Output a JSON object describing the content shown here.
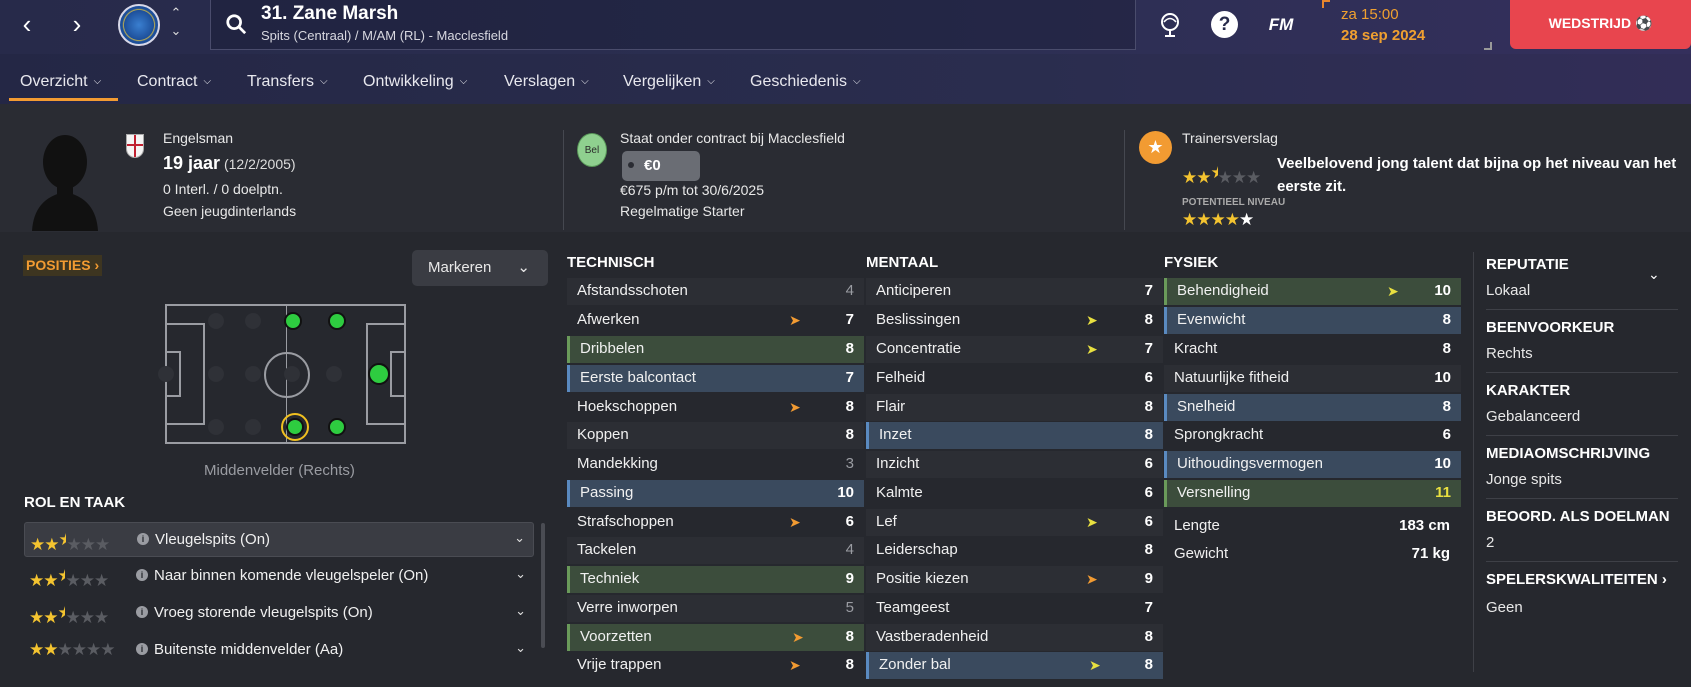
{
  "topbar": {
    "player_title": "31. Zane Marsh",
    "player_subtitle": "Spits (Centraal) / M/AM (RL) - Macclesfield",
    "fm_label": "FM",
    "help_label": "?",
    "time": "za 15:00",
    "date": "28 sep 2024",
    "match_button": "WEDSTRIJD"
  },
  "tabs": [
    {
      "label": "Overzicht"
    },
    {
      "label": "Contract"
    },
    {
      "label": "Transfers"
    },
    {
      "label": "Ontwikkeling"
    },
    {
      "label": "Verslagen"
    },
    {
      "label": "Vergelijken"
    },
    {
      "label": "Geschiedenis"
    }
  ],
  "header": {
    "nationality": "Engelsman",
    "age": "19 jaar",
    "dob": "(12/2/2005)",
    "caps": "0 Interl. / 0 doelptn.",
    "youth_caps": "Geen jeugdinterlands",
    "contract_status": "Staat onder contract bij Macclesfield",
    "value_badge": "Bel",
    "value": "€0",
    "wage": "€675 p/m tot 30/6/2025",
    "squad_status": "Regelmatige Starter",
    "trainer_label": "Trainersverslag",
    "current_ability_stars": 2.5,
    "potential_label": "POTENTIEEL NIVEAU",
    "potential_ability_stars": 4.5,
    "trainer_text": "Veelbelovend jong talent dat bijna op het niveau van het eerste zit."
  },
  "positions": {
    "label": "POSITIES",
    "mark_button": "Markeren",
    "position_name": "Middenvelder (Rechts)",
    "role_title": "ROL EN TAAK",
    "roles": [
      {
        "stars": 2.5,
        "label": "Vleugelspits (On)"
      },
      {
        "stars": 2.5,
        "label": "Naar binnen komende vleugelspeler (On)"
      },
      {
        "stars": 2.5,
        "label": "Vroeg storende vleugelspits (On)"
      },
      {
        "stars": 2,
        "label": "Buitenste middenvelder (Aa)"
      }
    ]
  },
  "attributes": {
    "technical_title": "TECHNISCH",
    "mental_title": "MENTAAL",
    "physical_title": "FYSIEK",
    "technical": [
      {
        "name": "Afstandsschoten",
        "value": "4"
      },
      {
        "name": "Afwerken",
        "value": "7"
      },
      {
        "name": "Dribbelen",
        "value": "8"
      },
      {
        "name": "Eerste balcontact",
        "value": "7"
      },
      {
        "name": "Hoekschoppen",
        "value": "8"
      },
      {
        "name": "Koppen",
        "value": "8"
      },
      {
        "name": "Mandekking",
        "value": "3"
      },
      {
        "name": "Passing",
        "value": "10"
      },
      {
        "name": "Strafschoppen",
        "value": "6"
      },
      {
        "name": "Tackelen",
        "value": "4"
      },
      {
        "name": "Techniek",
        "value": "9"
      },
      {
        "name": "Verre inworpen",
        "value": "5"
      },
      {
        "name": "Voorzetten",
        "value": "8"
      },
      {
        "name": "Vrije trappen",
        "value": "8"
      }
    ],
    "mental": [
      {
        "name": "Anticiperen",
        "value": "7"
      },
      {
        "name": "Beslissingen",
        "value": "8"
      },
      {
        "name": "Concentratie",
        "value": "7"
      },
      {
        "name": "Felheid",
        "value": "6"
      },
      {
        "name": "Flair",
        "value": "8"
      },
      {
        "name": "Inzet",
        "value": "8"
      },
      {
        "name": "Inzicht",
        "value": "6"
      },
      {
        "name": "Kalmte",
        "value": "6"
      },
      {
        "name": "Lef",
        "value": "6"
      },
      {
        "name": "Leiderschap",
        "value": "8"
      },
      {
        "name": "Positie kiezen",
        "value": "9"
      },
      {
        "name": "Teamgeest",
        "value": "7"
      },
      {
        "name": "Vastberadenheid",
        "value": "8"
      },
      {
        "name": "Zonder bal",
        "value": "8"
      }
    ],
    "physical": [
      {
        "name": "Behendigheid",
        "value": "10"
      },
      {
        "name": "Evenwicht",
        "value": "8"
      },
      {
        "name": "Kracht",
        "value": "8"
      },
      {
        "name": "Natuurlijke fitheid",
        "value": "10"
      },
      {
        "name": "Snelheid",
        "value": "8"
      },
      {
        "name": "Sprongkracht",
        "value": "6"
      },
      {
        "name": "Uithoudingsvermogen",
        "value": "10"
      },
      {
        "name": "Versnelling",
        "value": "11"
      }
    ],
    "height_label": "Lengte",
    "height": "183 cm",
    "weight_label": "Gewicht",
    "weight": "71 kg"
  },
  "side": {
    "reputation_title": "REPUTATIE",
    "reputation": "Lokaal",
    "foot_title": "BEENVOORKEUR",
    "foot": "Rechts",
    "character_title": "KARAKTER",
    "character": "Gebalanceerd",
    "media_title": "MEDIAOMSCHRIJVING",
    "media": "Jonge spits",
    "gk_title": "BEOORD. ALS DOELMAN",
    "gk": "2",
    "traits_title": "SPELERSKWALITEITEN",
    "traits": "Geen"
  },
  "colors": {
    "accent": "#f29b32",
    "match_button": "#e8454e",
    "green_highlight": "#3c4d3c",
    "blue_highlight": "#3a4a5e"
  }
}
